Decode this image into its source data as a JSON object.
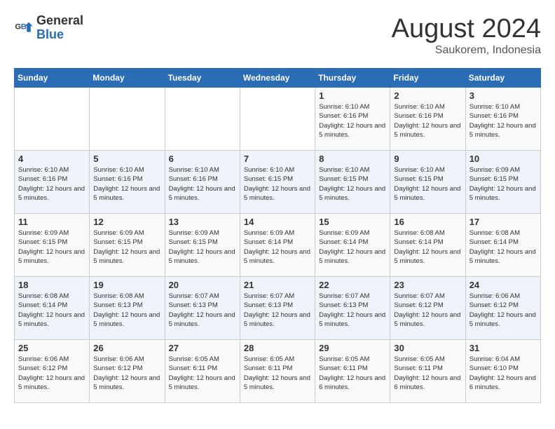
{
  "header": {
    "logo_line1": "General",
    "logo_line2": "Blue",
    "title": "August 2024",
    "subtitle": "Saukorem, Indonesia"
  },
  "weekdays": [
    "Sunday",
    "Monday",
    "Tuesday",
    "Wednesday",
    "Thursday",
    "Friday",
    "Saturday"
  ],
  "weeks": [
    [
      {
        "day": "",
        "info": ""
      },
      {
        "day": "",
        "info": ""
      },
      {
        "day": "",
        "info": ""
      },
      {
        "day": "",
        "info": ""
      },
      {
        "day": "1",
        "info": "Sunrise: 6:10 AM\nSunset: 6:16 PM\nDaylight: 12 hours and 5 minutes."
      },
      {
        "day": "2",
        "info": "Sunrise: 6:10 AM\nSunset: 6:16 PM\nDaylight: 12 hours and 5 minutes."
      },
      {
        "day": "3",
        "info": "Sunrise: 6:10 AM\nSunset: 6:16 PM\nDaylight: 12 hours and 5 minutes."
      }
    ],
    [
      {
        "day": "4",
        "info": "Sunrise: 6:10 AM\nSunset: 6:16 PM\nDaylight: 12 hours and 5 minutes."
      },
      {
        "day": "5",
        "info": "Sunrise: 6:10 AM\nSunset: 6:16 PM\nDaylight: 12 hours and 5 minutes."
      },
      {
        "day": "6",
        "info": "Sunrise: 6:10 AM\nSunset: 6:16 PM\nDaylight: 12 hours and 5 minutes."
      },
      {
        "day": "7",
        "info": "Sunrise: 6:10 AM\nSunset: 6:15 PM\nDaylight: 12 hours and 5 minutes."
      },
      {
        "day": "8",
        "info": "Sunrise: 6:10 AM\nSunset: 6:15 PM\nDaylight: 12 hours and 5 minutes."
      },
      {
        "day": "9",
        "info": "Sunrise: 6:10 AM\nSunset: 6:15 PM\nDaylight: 12 hours and 5 minutes."
      },
      {
        "day": "10",
        "info": "Sunrise: 6:09 AM\nSunset: 6:15 PM\nDaylight: 12 hours and 5 minutes."
      }
    ],
    [
      {
        "day": "11",
        "info": "Sunrise: 6:09 AM\nSunset: 6:15 PM\nDaylight: 12 hours and 5 minutes."
      },
      {
        "day": "12",
        "info": "Sunrise: 6:09 AM\nSunset: 6:15 PM\nDaylight: 12 hours and 5 minutes."
      },
      {
        "day": "13",
        "info": "Sunrise: 6:09 AM\nSunset: 6:15 PM\nDaylight: 12 hours and 5 minutes."
      },
      {
        "day": "14",
        "info": "Sunrise: 6:09 AM\nSunset: 6:14 PM\nDaylight: 12 hours and 5 minutes."
      },
      {
        "day": "15",
        "info": "Sunrise: 6:09 AM\nSunset: 6:14 PM\nDaylight: 12 hours and 5 minutes."
      },
      {
        "day": "16",
        "info": "Sunrise: 6:08 AM\nSunset: 6:14 PM\nDaylight: 12 hours and 5 minutes."
      },
      {
        "day": "17",
        "info": "Sunrise: 6:08 AM\nSunset: 6:14 PM\nDaylight: 12 hours and 5 minutes."
      }
    ],
    [
      {
        "day": "18",
        "info": "Sunrise: 6:08 AM\nSunset: 6:14 PM\nDaylight: 12 hours and 5 minutes."
      },
      {
        "day": "19",
        "info": "Sunrise: 6:08 AM\nSunset: 6:13 PM\nDaylight: 12 hours and 5 minutes."
      },
      {
        "day": "20",
        "info": "Sunrise: 6:07 AM\nSunset: 6:13 PM\nDaylight: 12 hours and 5 minutes."
      },
      {
        "day": "21",
        "info": "Sunrise: 6:07 AM\nSunset: 6:13 PM\nDaylight: 12 hours and 5 minutes."
      },
      {
        "day": "22",
        "info": "Sunrise: 6:07 AM\nSunset: 6:13 PM\nDaylight: 12 hours and 5 minutes."
      },
      {
        "day": "23",
        "info": "Sunrise: 6:07 AM\nSunset: 6:12 PM\nDaylight: 12 hours and 5 minutes."
      },
      {
        "day": "24",
        "info": "Sunrise: 6:06 AM\nSunset: 6:12 PM\nDaylight: 12 hours and 5 minutes."
      }
    ],
    [
      {
        "day": "25",
        "info": "Sunrise: 6:06 AM\nSunset: 6:12 PM\nDaylight: 12 hours and 5 minutes."
      },
      {
        "day": "26",
        "info": "Sunrise: 6:06 AM\nSunset: 6:12 PM\nDaylight: 12 hours and 5 minutes."
      },
      {
        "day": "27",
        "info": "Sunrise: 6:05 AM\nSunset: 6:11 PM\nDaylight: 12 hours and 5 minutes."
      },
      {
        "day": "28",
        "info": "Sunrise: 6:05 AM\nSunset: 6:11 PM\nDaylight: 12 hours and 5 minutes."
      },
      {
        "day": "29",
        "info": "Sunrise: 6:05 AM\nSunset: 6:11 PM\nDaylight: 12 hours and 6 minutes."
      },
      {
        "day": "30",
        "info": "Sunrise: 6:05 AM\nSunset: 6:11 PM\nDaylight: 12 hours and 6 minutes."
      },
      {
        "day": "31",
        "info": "Sunrise: 6:04 AM\nSunset: 6:10 PM\nDaylight: 12 hours and 6 minutes."
      }
    ]
  ]
}
